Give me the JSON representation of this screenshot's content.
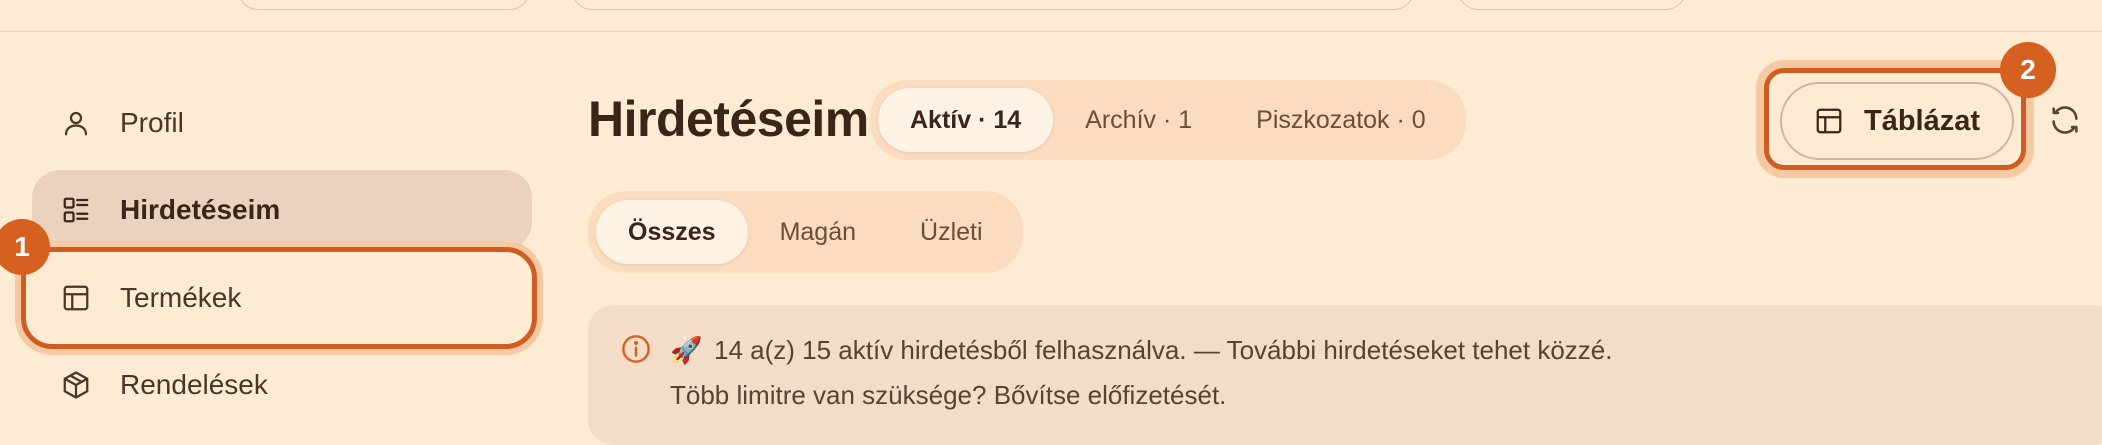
{
  "sidebar": {
    "items": [
      {
        "label": "Profil",
        "icon": "user-icon"
      },
      {
        "label": "Hirdetéseim",
        "icon": "list-icon",
        "active": true
      },
      {
        "label": "Termékek",
        "icon": "table-icon",
        "highlighted": true
      },
      {
        "label": "Rendelések",
        "icon": "package-icon"
      }
    ]
  },
  "badges": {
    "one": "1",
    "two": "2"
  },
  "main": {
    "title": "Hirdetéseim",
    "status_tabs": [
      "Aktív · 14",
      "Archív · 1",
      "Piszkozatok · 0"
    ],
    "type_tabs": [
      "Összes",
      "Magán",
      "Üzleti"
    ],
    "table_button_label": "Táblázat",
    "notice": {
      "emoji": "🚀",
      "line1": "14 a(z) 15 aktív hirdetésből felhasználva. — További hirdetéseket tehet közzé.",
      "line2": "Több limitre van szüksége? Bővítse előfizetését."
    }
  },
  "colors": {
    "background": "#fdebd3",
    "accent": "#d6601f",
    "segment_bg": "#fbdcbf",
    "active_nav_bg": "#ebd2bf",
    "notice_bg": "#f3dcc8"
  }
}
